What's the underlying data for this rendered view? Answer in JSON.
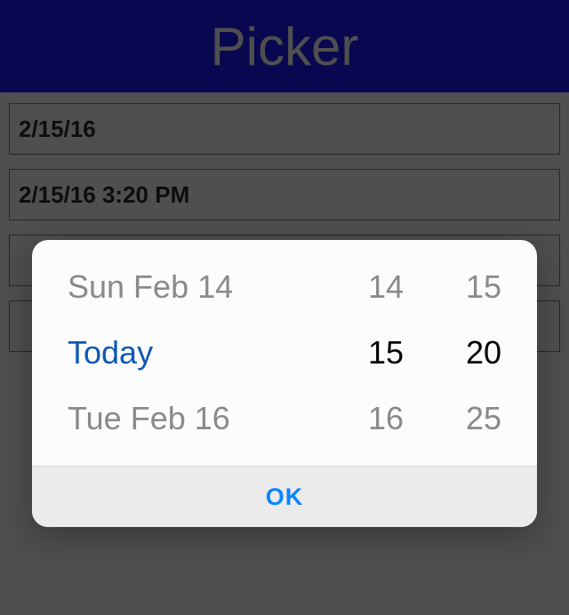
{
  "header": {
    "title": "Picker"
  },
  "fields": {
    "date_value": "2/15/16",
    "datetime_value": "2/15/16 3:20 PM"
  },
  "picker": {
    "date": {
      "prev": "Sun Feb 14",
      "sel": "Today",
      "next": "Tue Feb 16"
    },
    "hour": {
      "prev": "14",
      "sel": "15",
      "next": "16"
    },
    "minute": {
      "prev": "15",
      "sel": "20",
      "next": "25"
    },
    "ok_label": "OK"
  }
}
